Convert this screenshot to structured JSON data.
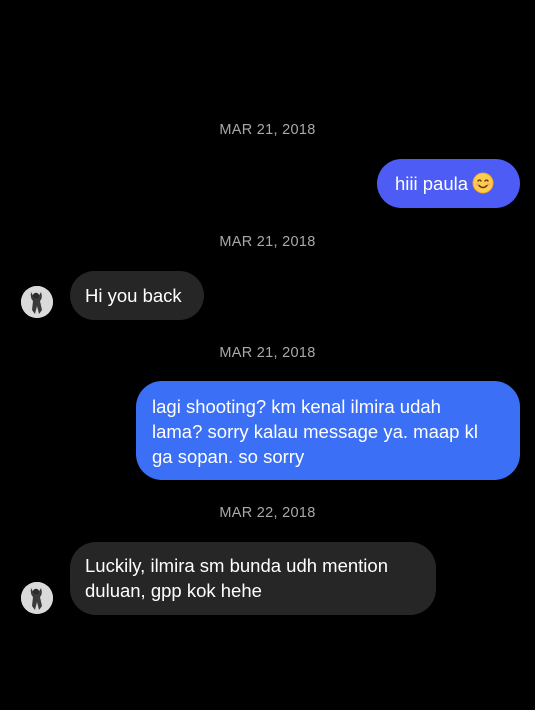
{
  "conversation": {
    "stamps": [
      "MAR 21, 2018",
      "MAR 21, 2018",
      "MAR 21, 2018",
      "MAR 22, 2018"
    ],
    "messages": [
      {
        "sender": "me",
        "text": "hiii paula",
        "emoji": "smiling-face-icon"
      },
      {
        "sender": "them",
        "text": "Hi you back"
      },
      {
        "sender": "me",
        "lines": [
          "lagi shooting? km kenal ilmira udah",
          "lama? sorry kalau message ya. maap kl",
          "ga sopan. so sorry"
        ]
      },
      {
        "sender": "them",
        "lines": [
          "Luckily, ilmira sm bunda udh mention",
          "duluan, gpp kok hehe"
        ]
      }
    ]
  },
  "colors": {
    "background": "#000000",
    "outgoing_bubble": "#3b70f6",
    "outgoing_bubble_first": "#4c5cf4",
    "incoming_bubble": "#262626",
    "timestamp": "#a8a8a8"
  }
}
